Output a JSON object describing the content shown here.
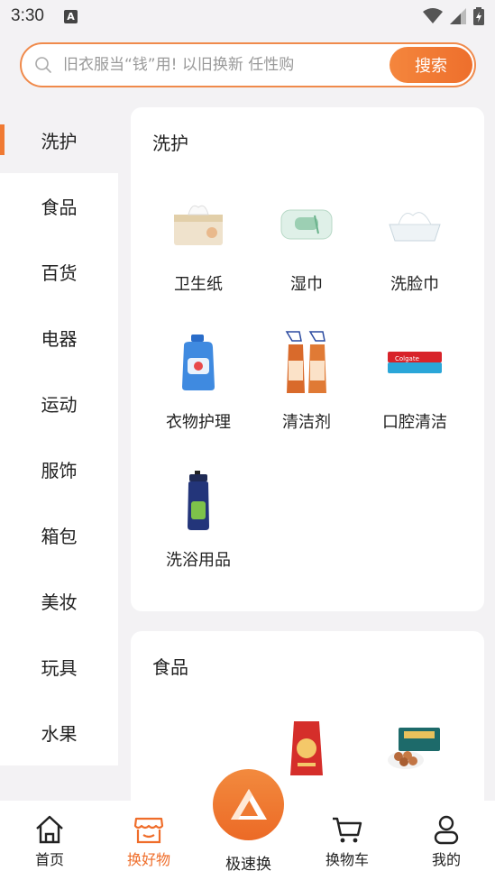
{
  "status_bar": {
    "time": "3:30",
    "notif_letter": "A"
  },
  "search": {
    "placeholder": "旧衣服当“钱”用! 以旧换新 任性购",
    "button_label": "搜索"
  },
  "sidebar": {
    "items": [
      {
        "label": "洗护",
        "active": true
      },
      {
        "label": "食品"
      },
      {
        "label": "百货"
      },
      {
        "label": "电器"
      },
      {
        "label": "运动"
      },
      {
        "label": "服饰"
      },
      {
        "label": "箱包"
      },
      {
        "label": "美妆"
      },
      {
        "label": "玩具"
      },
      {
        "label": "水果"
      }
    ]
  },
  "sections": [
    {
      "title": "洗护",
      "items": [
        {
          "label": "卫生纸",
          "icon": "tissue-box-icon"
        },
        {
          "label": "湿巾",
          "icon": "wet-wipes-icon"
        },
        {
          "label": "洗脸巾",
          "icon": "face-towel-icon"
        },
        {
          "label": "衣物护理",
          "icon": "detergent-bottle-icon"
        },
        {
          "label": "清洁剂",
          "icon": "spray-cleaner-icon"
        },
        {
          "label": "口腔清洁",
          "icon": "toothpaste-icon"
        },
        {
          "label": "洗浴用品",
          "icon": "shampoo-bottle-icon"
        }
      ]
    },
    {
      "title": "食品",
      "items": [
        {
          "label": "",
          "icon": "rice-bag-icon"
        },
        {
          "label": "",
          "icon": "nut-gift-box-icon"
        }
      ]
    }
  ],
  "bottom_nav": {
    "items": [
      {
        "label": "首页",
        "icon": "home-icon"
      },
      {
        "label": "换好物",
        "icon": "shop-icon",
        "active": true
      },
      {
        "label": "极速换",
        "icon": "quick-exchange-icon"
      },
      {
        "label": "换物车",
        "icon": "cart-icon"
      },
      {
        "label": "我的",
        "icon": "user-icon"
      }
    ]
  },
  "colors": {
    "accent": "#ef6d2a",
    "background": "#f3f2f4"
  }
}
